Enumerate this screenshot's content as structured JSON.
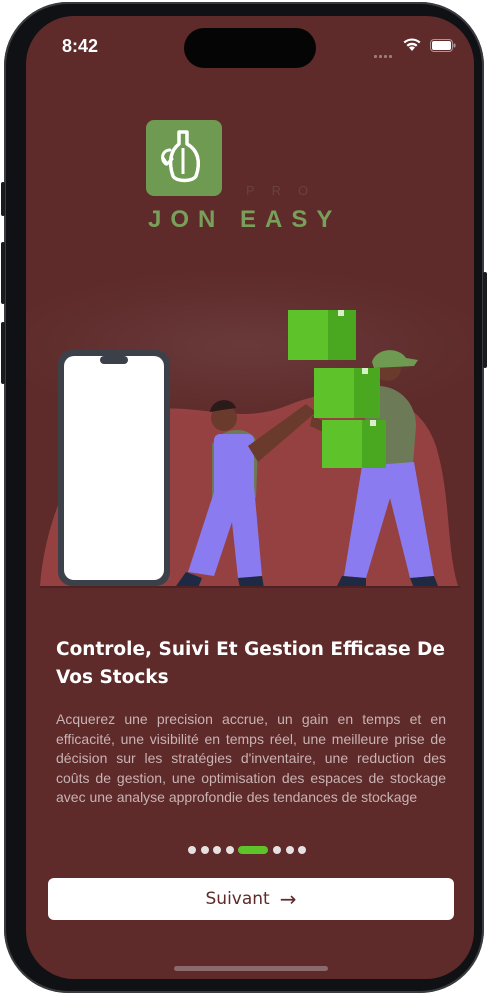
{
  "status_bar": {
    "time": "8:42"
  },
  "brand": {
    "pro_label": "PRO",
    "name": "JON EASY",
    "logo_icon": "bottle-refresh-icon",
    "logo_color": "#6f9a52"
  },
  "onboarding": {
    "title": "Controle, Suivi Et Gestion Efficase De Vos Stocks",
    "description": "Acquerez une precision accrue, un gain en temps et en efficacité, une visibilité en temps réel, une meilleure prise de décision sur les stratégies d'inventaire, une reduction des coûts de gestion, une optimisation des espaces de stockage avec une analyse approfondie des tendances de stockage",
    "illustration_icon": "warehouse-workers-boxes-illustration"
  },
  "pagination": {
    "total": 8,
    "current": 5
  },
  "next_button": {
    "label": "Suivant",
    "icon": "arrow-right-icon"
  },
  "colors": {
    "background": "#5e2a2a",
    "accent": "#5ec22b",
    "brand_green": "#78a05a"
  }
}
